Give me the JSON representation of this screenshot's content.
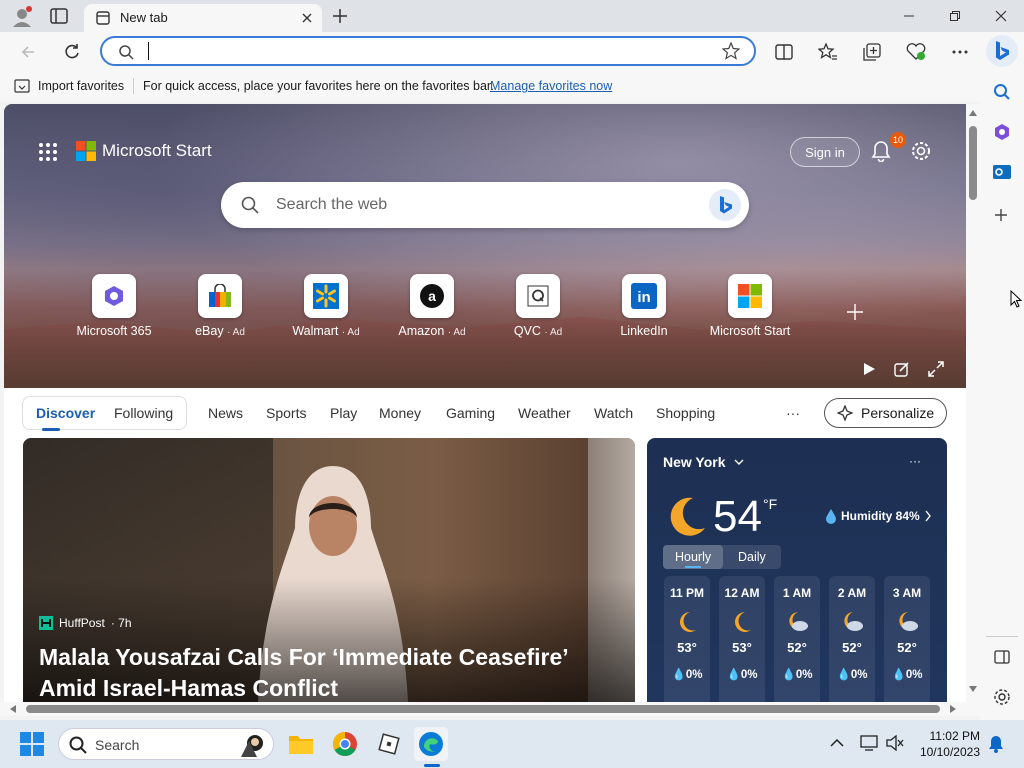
{
  "browser": {
    "tab_title": "New tab",
    "address_value": "",
    "favorites_bar": {
      "import_label": "Import favorites",
      "message": "For quick access, place your favorites here on the favorites bar.",
      "manage_link": "Manage favorites now"
    }
  },
  "start": {
    "brand": "Microsoft Start",
    "sign_in": "Sign in",
    "notification_count": "10",
    "search_placeholder": "Search the web",
    "tiles": [
      {
        "name": "Microsoft 365",
        "ad": ""
      },
      {
        "name": "eBay",
        "ad": "· Ad"
      },
      {
        "name": "Walmart",
        "ad": "· Ad"
      },
      {
        "name": "Amazon",
        "ad": "· Ad"
      },
      {
        "name": "QVC",
        "ad": "· Ad"
      },
      {
        "name": "LinkedIn",
        "ad": ""
      },
      {
        "name": "Microsoft Start",
        "ad": ""
      }
    ],
    "nav": {
      "discover": "Discover",
      "following": "Following",
      "items": [
        "News",
        "Sports",
        "Play",
        "Money",
        "Gaming",
        "Weather",
        "Watch",
        "Shopping"
      ],
      "more": "···",
      "personalize": "Personalize"
    },
    "news": {
      "source": "HuffPost",
      "age": "· 7h",
      "headline": "Malala Yousafzai Calls For ‘Immediate Ceasefire’ Amid Israel-Hamas Conflict"
    },
    "weather": {
      "city": "New York",
      "temperature": "54",
      "unit": "°F",
      "humidity": "Humidity 84%",
      "tab_hourly": "Hourly",
      "tab_daily": "Daily",
      "more": "···",
      "hours": [
        {
          "time": "11 PM",
          "temp": "53°",
          "precip": "0%",
          "icon": "moon-icon"
        },
        {
          "time": "12 AM",
          "temp": "53°",
          "precip": "0%",
          "icon": "moon-icon"
        },
        {
          "time": "1 AM",
          "temp": "52°",
          "precip": "0%",
          "icon": "cloudy-moon-icon"
        },
        {
          "time": "2 AM",
          "temp": "52°",
          "precip": "0%",
          "icon": "cloudy-moon-icon"
        },
        {
          "time": "3 AM",
          "temp": "52°",
          "precip": "0%",
          "icon": "cloudy-moon-icon"
        }
      ]
    }
  },
  "taskbar": {
    "search_label": "Search",
    "time": "11:02 PM",
    "date": "10/10/2023"
  },
  "colors": {
    "accent": "#3a7bd5",
    "link": "#1a5fb4",
    "weather_bg": "#1d2f52"
  }
}
